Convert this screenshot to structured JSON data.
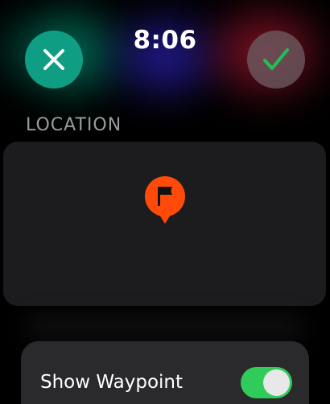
{
  "status": {
    "time": "8:06"
  },
  "actions": {
    "cancel_icon": "close-icon",
    "confirm_icon": "checkmark-icon"
  },
  "location": {
    "section_label": "LOCATION",
    "pin_icon": "flag-pin-icon",
    "pin_color": "#ff4a0a"
  },
  "settings": {
    "show_waypoint_label": "Show Waypoint",
    "show_waypoint_on": true,
    "toggle_on_color": "#2fcc5a"
  },
  "colors": {
    "cancel_button": "#0f9e84",
    "confirm_checkmark": "#1fbf5a",
    "background": "#000000",
    "card": "#1c1c1e"
  }
}
